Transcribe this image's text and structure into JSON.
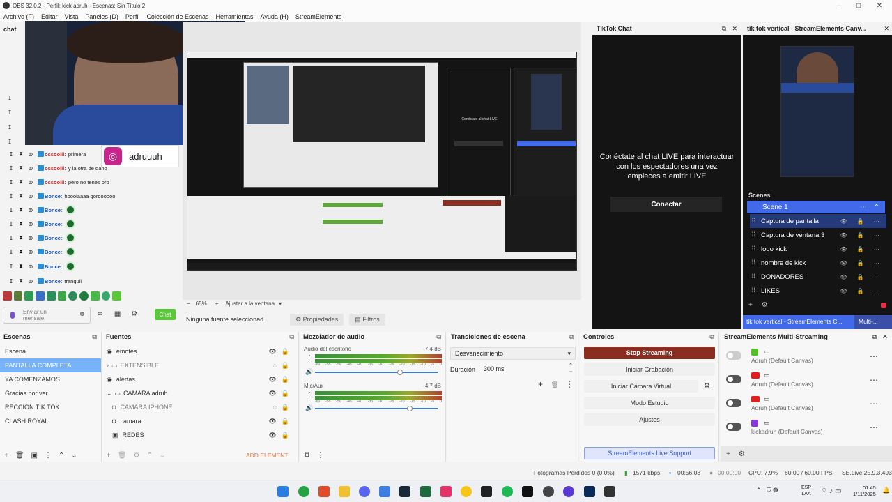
{
  "window": {
    "title": "OBS 32.0.2 - Perfil: kick adruh - Escenas: Sin Título 2"
  },
  "menu": [
    "Archivo (F)",
    "Editar",
    "Vista",
    "Paneles (D)",
    "Perfil",
    "Colección de Escenas",
    "Herramientas",
    "Ayuda (H)",
    "StreamElements"
  ],
  "chat": {
    "title": "chat",
    "instagram_handle": "adruuuh",
    "messages": [
      {
        "user": "ossoolil:",
        "text": "primera"
      },
      {
        "user": "ossoolil:",
        "text": "y la otra de daño"
      },
      {
        "user": "ossoolil:",
        "text": "pero no tenes oro"
      },
      {
        "user": "Bonce:",
        "text": "hooolaaaa gordooooo"
      },
      {
        "user": "Bonce:",
        "text": ""
      },
      {
        "user": "Bonce:",
        "text": ""
      },
      {
        "user": "Bonce:",
        "text": ""
      },
      {
        "user": "Bonce:",
        "text": ""
      },
      {
        "user": "Bonce:",
        "text": ""
      },
      {
        "user": "Bonce:",
        "text": "tranquii"
      }
    ],
    "input_placeholder": "Enviar un mensaje",
    "send_label": "Chat"
  },
  "preview": {
    "zoom": "65%",
    "fit_label": "Ajustar a la ventana",
    "no_source": "Ninguna fuente seleccionad",
    "properties_label": "Propiedades",
    "filters_label": "Filtros"
  },
  "tiktok": {
    "title": "TikTok Chat",
    "message": "Conéctate al chat LIVE para interactuar con los espectadores una vez empieces a emitir LIVE",
    "connect_label": "Conectar"
  },
  "se_canvas": {
    "title": "tik tok vertical - StreamElements Canv...",
    "scenes_label": "Scenes",
    "scene_selected": "Scene 1",
    "items": [
      "Captura de pantalla",
      "Captura de ventana 3",
      "logo kick",
      "nombre de kick",
      "DONADORES",
      "LIKES"
    ],
    "tab_active": "tik tok vertical - StreamElements C...",
    "tab_other": "Multi-..."
  },
  "scenes": {
    "title": "Escenas",
    "items": [
      "Escena",
      "PANTALLA COMPLETA",
      "YA COMENZAMOS",
      "Gracias por ver",
      "RECCION TIK TOK",
      "CLASH ROYAL"
    ],
    "selected_index": 1
  },
  "sources": {
    "title": "Fuentes",
    "items": [
      "emotes",
      "EXTENSIBLE",
      "alertas",
      "CAMARA adruh",
      "CAMARA IPHONE",
      "camara",
      "REDES"
    ],
    "add_label": "ADD ELEMENT"
  },
  "mixer": {
    "title": "Mezclador de audio",
    "tracks": [
      {
        "name": "Audio del escritorio",
        "db": "-7.4 dB"
      },
      {
        "name": "Mic/Aux",
        "db": "-4.7 dB"
      }
    ],
    "scale": [
      "-60",
      "-55",
      "-50",
      "-45",
      "-40",
      "-35",
      "-30",
      "-25",
      "-20",
      "-15",
      "-10",
      "-5",
      "0"
    ]
  },
  "transitions": {
    "title": "Transiciones de escena",
    "selected": "Desvanecimiento",
    "duration_label": "Duración",
    "duration_value": "300 ms"
  },
  "controls": {
    "title": "Controles",
    "buttons": [
      "Stop Streaming",
      "Iniciar Grabación",
      "Iniciar Cámara Virtual",
      "Modo Estudio",
      "Ajustes"
    ],
    "support_label": "StreamElements Live Support"
  },
  "multistream": {
    "title": "StreamElements Multi-Streaming",
    "rows": [
      "Adruh (Default Canvas)",
      "Adruh (Default Canvas)",
      "Adruh (Default Canvas)",
      "kickadruh (Default Canvas)"
    ]
  },
  "status": {
    "dropped": "Fotogramas Perdidos 0 (0.0%)",
    "bitrate": "1571 kbps",
    "live_time": "00:56:08",
    "rec_time": "00:00:00",
    "cpu": "CPU: 7.9%",
    "fps": "60.00 / 60.00 FPS",
    "version": "SE.Live 25.9.3.493"
  },
  "taskbar": {
    "lang_top": "ESP",
    "lang_bottom": "LAA",
    "time": "01:45",
    "date": "1/11/2025"
  },
  "colors": {
    "accent": "#4269e8",
    "stop_stream": "#8b2e22",
    "chat_btn": "#5ac83a"
  }
}
